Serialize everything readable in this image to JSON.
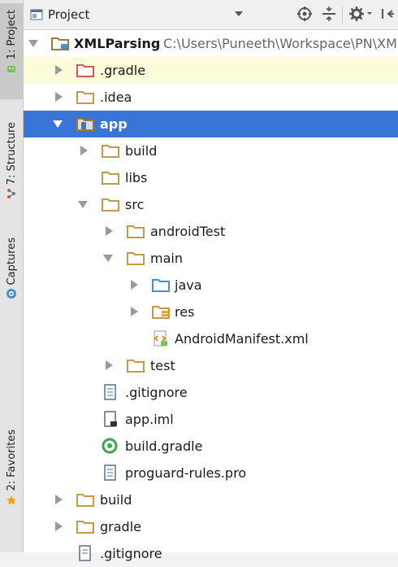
{
  "side_tabs": {
    "project": "1: Project",
    "structure": "7: Structure",
    "captures": "Captures",
    "favorites": "2: Favorites"
  },
  "toolbar": {
    "view_label": "Project",
    "buttons": [
      "target-icon",
      "collapse-icon",
      "gear-icon",
      "hide-icon"
    ]
  },
  "tree": {
    "root_name": "XMLParsing",
    "root_path": "C:\\Users\\Puneeth\\Workspace\\PN\\XM",
    "items": [
      {
        "label": ".gradle"
      },
      {
        "label": ".idea"
      },
      {
        "label": "app"
      },
      {
        "label": "build"
      },
      {
        "label": "libs"
      },
      {
        "label": "src"
      },
      {
        "label": "androidTest"
      },
      {
        "label": "main"
      },
      {
        "label": "java"
      },
      {
        "label": "res"
      },
      {
        "label": "AndroidManifest.xml"
      },
      {
        "label": "test"
      },
      {
        "label": ".gitignore"
      },
      {
        "label": "app.iml"
      },
      {
        "label": "build.gradle"
      },
      {
        "label": "proguard-rules.pro"
      },
      {
        "label": "build"
      },
      {
        "label": "gradle"
      },
      {
        "label": ".gitignore"
      }
    ]
  },
  "colors": {
    "selection": "#3875d7",
    "highlight": "#fcfcdb",
    "folder": "#c49a4a",
    "folder_excluded": "#d9534f",
    "source_folder": "#4a90c9",
    "favorites_star": "#f0a30a"
  }
}
